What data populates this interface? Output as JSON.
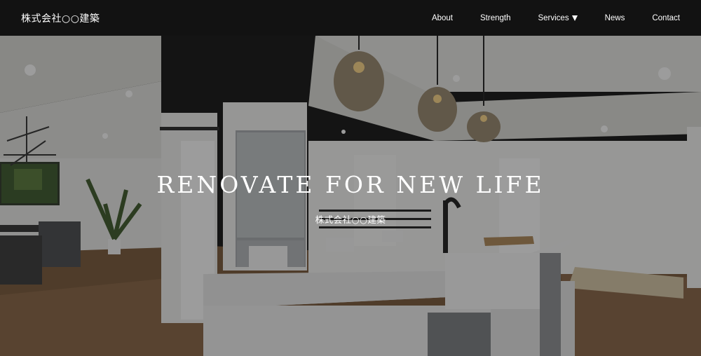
{
  "header": {
    "logo": "株式会社○○建築",
    "nav": [
      {
        "label": "About"
      },
      {
        "label": "Strength"
      },
      {
        "label": "Services"
      },
      {
        "label": "News"
      },
      {
        "label": "Contact"
      }
    ]
  },
  "hero": {
    "title": "RENOVATE FOR NEW LIFE",
    "subtitle": "株式会社○○建築",
    "image_icon": "kitchen-interior-photo"
  },
  "colors": {
    "header_bg": "#121212",
    "text": "#ffffff"
  }
}
